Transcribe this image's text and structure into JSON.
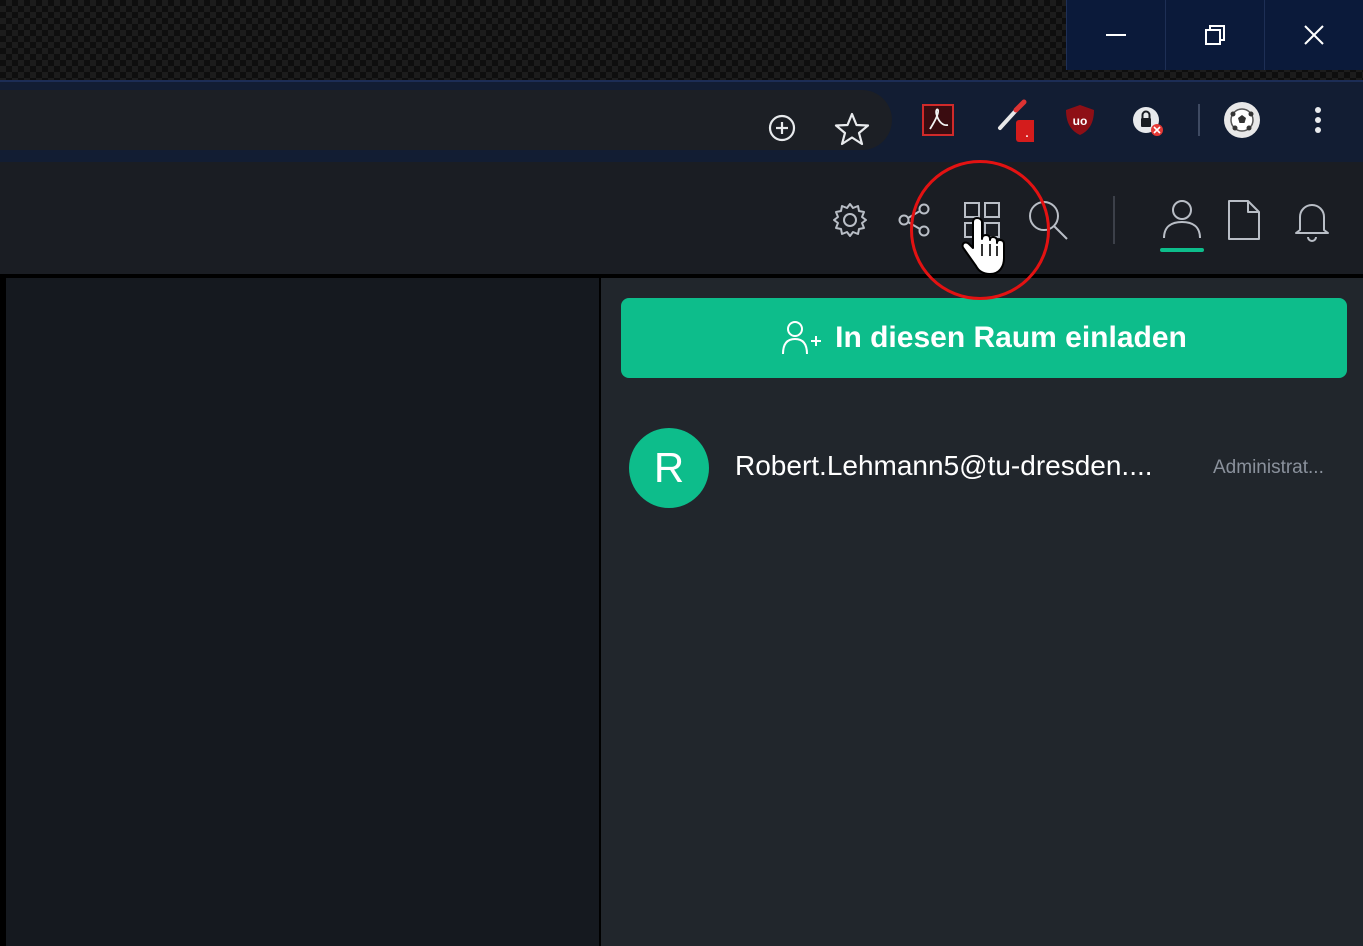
{
  "window": {
    "controls": [
      "minimize",
      "restore",
      "close"
    ]
  },
  "toolbar": {
    "icons": [
      "zoom-icon",
      "bookmark-star-icon",
      "pdf-extension-icon",
      "color-picker-extension-icon",
      "ublock-extension-icon",
      "password-extension-icon",
      "profile-avatar-icon",
      "more-menu-icon"
    ],
    "badge_text": "."
  },
  "app_header": {
    "icons": [
      "settings-icon",
      "share-icon",
      "widgets-icon",
      "search-icon",
      "people-icon",
      "files-icon",
      "notifications-icon"
    ],
    "active_icon": "people-icon",
    "accent": "#0dbd8b"
  },
  "right_panel": {
    "invite_label": "In diesen Raum einladen",
    "members": [
      {
        "initial": "R",
        "name": "Robert.Lehmann5@tu-dresden....",
        "role": "Administrat..."
      }
    ]
  },
  "annotation": {
    "color": "#e31212"
  }
}
